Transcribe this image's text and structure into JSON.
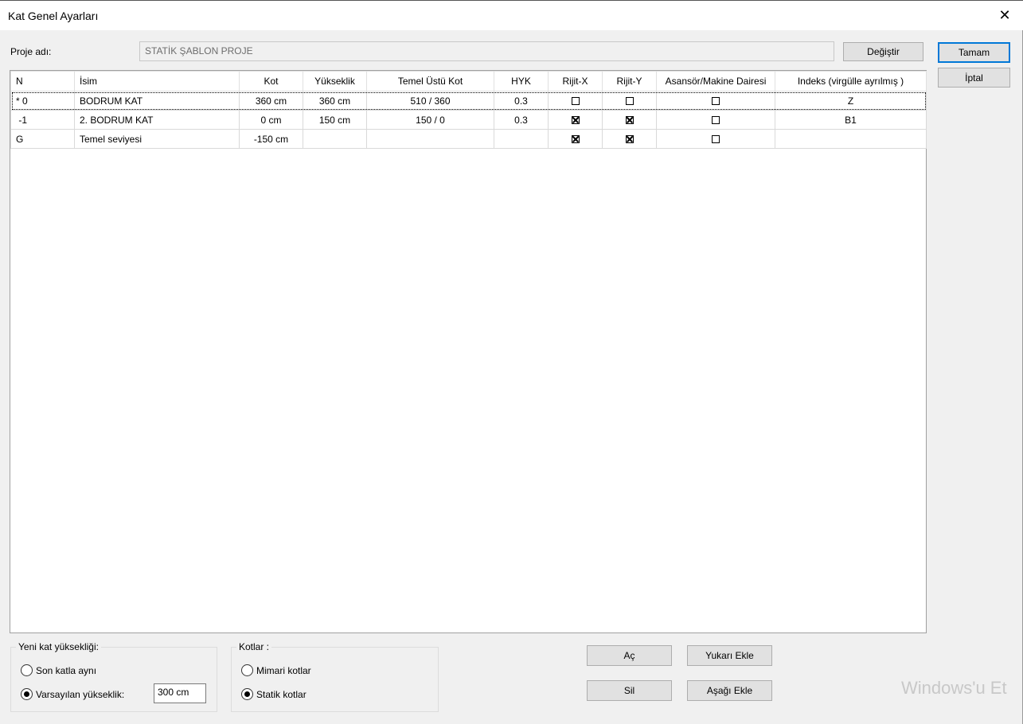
{
  "window": {
    "title": "Kat Genel Ayarları",
    "close_glyph": "✕"
  },
  "project": {
    "label": "Proje adı:",
    "value": "STATİK ŞABLON PROJE",
    "change_button": "Değiştir"
  },
  "buttons": {
    "ok": "Tamam",
    "cancel": "İptal",
    "open": "Aç",
    "delete": "Sil",
    "add_above": "Yukarı Ekle",
    "add_below": "Aşağı Ekle"
  },
  "table": {
    "headers": [
      "N",
      "İsim",
      "Kot",
      "Yükseklik",
      "Temel Üstü Kot",
      "HYK",
      "Rijit-X",
      "Rijit-Y",
      "Asansör/Makine Dairesi",
      "Indeks (virgülle ayrılmış )"
    ],
    "rows": [
      {
        "n": "* 0",
        "isim": "BODRUM KAT",
        "kot": "360 cm",
        "yukseklik": "360 cm",
        "temel_ustu_kot": "510 / 360",
        "hyk": "0.3",
        "rijit_x": false,
        "rijit_y": false,
        "asansor": false,
        "indeks": "Z"
      },
      {
        "n": " -1",
        "isim": "2. BODRUM KAT",
        "kot": "0 cm",
        "yukseklik": "150 cm",
        "temel_ustu_kot": "150 / 0",
        "hyk": "0.3",
        "rijit_x": true,
        "rijit_y": true,
        "asansor": false,
        "indeks": "B1"
      },
      {
        "n": "G",
        "isim": "Temel seviyesi",
        "kot": "-150 cm",
        "yukseklik": "",
        "temel_ustu_kot": "",
        "hyk": "",
        "rijit_x": true,
        "rijit_y": true,
        "asansor": false,
        "indeks": ""
      }
    ]
  },
  "new_floor_height": {
    "legend": "Yeni kat yüksekliği:",
    "option_same": "Son katla aynı",
    "option_default": "Varsayılan yükseklik:",
    "default_value": "300 cm",
    "selected": "default"
  },
  "levels": {
    "legend": "Kotlar :",
    "option_arch": "Mimari kotlar",
    "option_static": "Statik kotlar",
    "selected": "static"
  },
  "watermark": "Windows'u Et"
}
